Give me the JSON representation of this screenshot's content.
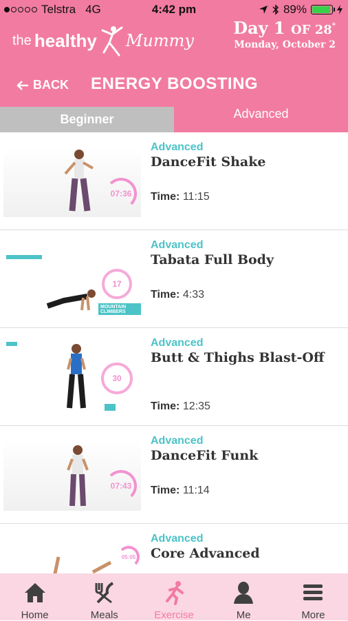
{
  "status": {
    "carrier": "Telstra",
    "network": "4G",
    "time": "4:42 pm",
    "battery": "89%"
  },
  "brand": {
    "part1": "the",
    "part2": "healthy",
    "part3": "Mummy"
  },
  "day": {
    "label": "Day 1",
    "of": "OF 28",
    "date": "Monday, October 2"
  },
  "nav": {
    "back_label": "BACK",
    "title": "ENERGY BOOSTING"
  },
  "tabs": [
    {
      "label": "Beginner"
    },
    {
      "label": "Advanced"
    }
  ],
  "workouts": [
    {
      "level": "Advanced",
      "title": "DanceFit Shake",
      "time_label": "Time:",
      "time": "11:15",
      "ring": "07:36"
    },
    {
      "level": "Advanced",
      "title": "Tabata Full Body",
      "time_label": "Time:",
      "time": "4:33",
      "ring": "17",
      "caption": "MOUNTAIN CLIMBERS"
    },
    {
      "level": "Advanced",
      "title": "Butt & Thighs Blast-Off",
      "time_label": "Time:",
      "time": "12:35",
      "ring": "30"
    },
    {
      "level": "Advanced",
      "title": "DanceFit Funk",
      "time_label": "Time:",
      "time": "11:14",
      "ring": "07:43"
    },
    {
      "level": "Advanced",
      "title": "Core Advanced",
      "ring": "05:05"
    }
  ],
  "tabbar": [
    {
      "label": "Home",
      "icon": "home-icon"
    },
    {
      "label": "Meals",
      "icon": "fork-knife-icon"
    },
    {
      "label": "Exercise",
      "icon": "runner-icon"
    },
    {
      "label": "Me",
      "icon": "person-icon"
    },
    {
      "label": "More",
      "icon": "hamburger-icon"
    }
  ],
  "colors": {
    "brand_pink": "#f27ba1",
    "accent_teal": "#4cc3c7",
    "tabbar_bg": "#fad7e2",
    "inactive_tab": "#bfbfbf"
  }
}
